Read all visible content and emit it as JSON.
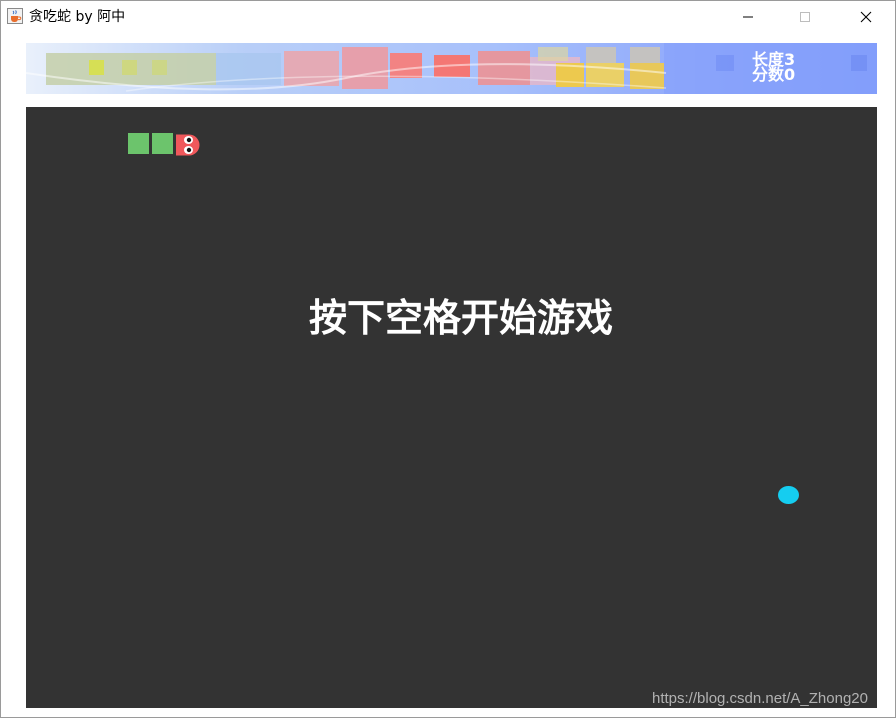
{
  "window": {
    "title": "贪吃蛇 by 阿中",
    "icon": "java-cup-icon",
    "controls": [
      "minimize-icon",
      "maximize-icon",
      "close-icon"
    ]
  },
  "stats": {
    "length_label": "长度3",
    "score_label": "分数0",
    "length": 3,
    "score": 0
  },
  "board": {
    "message": "按下空格开始游戏",
    "background": "#333333",
    "snake_body_color": "#6cc46c",
    "snake_head_color": "#f0585b",
    "food_color": "#15cdf0",
    "snake_direction": "right",
    "food_icon": "food-circle"
  },
  "watermark": "https://blog.csdn.net/A_Zhong20"
}
